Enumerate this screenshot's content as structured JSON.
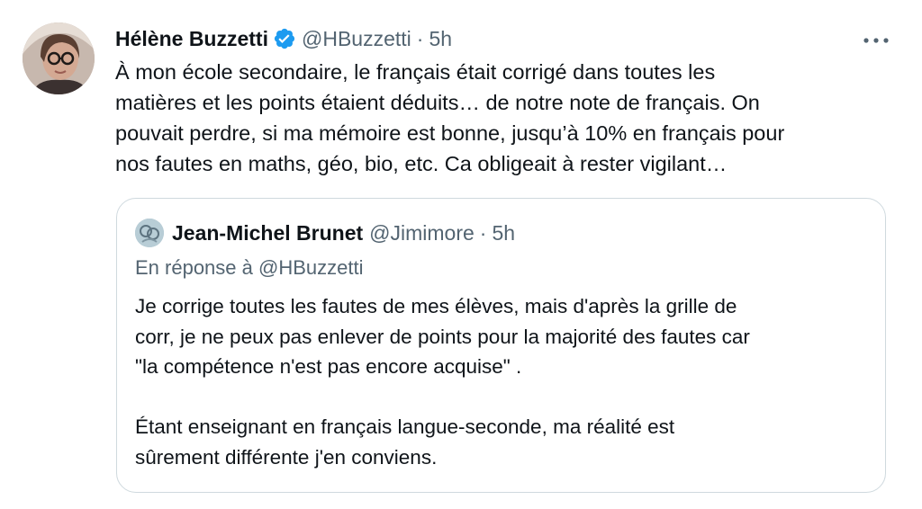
{
  "tweet": {
    "author_name": "Hélène Buzzetti",
    "handle": "@HBuzzetti",
    "separator": "·",
    "time": "5h",
    "more_icon": "more-horizontal-icon",
    "verified_icon": "verified-badge-icon",
    "text_lines": [
      "À mon école secondaire, le français était corrigé dans toutes les",
      "matières et les points étaient déduits… de notre note de français. On",
      "pouvait perdre, si ma mémoire est bonne, jusqu’à 10% en français pour",
      "nos fautes en maths, géo, bio, etc. Ca obligeait à rester vigilant…"
    ]
  },
  "quoted_tweet": {
    "author_name": "Jean-Michel Brunet",
    "handle": "@Jimimore",
    "separator": "·",
    "time": "5h",
    "reply_to": "En réponse à @HBuzzetti",
    "text_lines": [
      "Je corrige toutes les fautes de mes élèves, mais d'après la grille de",
      "corr, je ne peux pas enlever de points pour la majorité des fautes car",
      "\"la compétence n'est pas encore acquise\" .",
      "",
      "Étant enseignant en français langue-seconde, ma réalité est",
      "sûrement différente j'en conviens."
    ]
  },
  "colors": {
    "text_primary": "#0f1419",
    "text_secondary": "#536471",
    "verified_blue": "#1d9bf0",
    "border": "#cfd9de"
  }
}
